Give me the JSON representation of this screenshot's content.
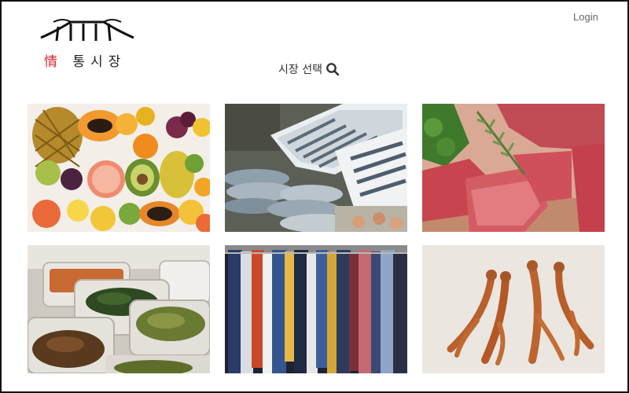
{
  "header": {
    "logo": {
      "red_char": "情",
      "rest_text": " 통시장"
    },
    "login_label": "Login"
  },
  "market_select": {
    "label": "시장 선택",
    "icon": "search-icon"
  },
  "categories": [
    {
      "id": "fruits",
      "icon": "fruit-photo"
    },
    {
      "id": "seafood",
      "icon": "fish-photo"
    },
    {
      "id": "meat",
      "icon": "meat-photo"
    },
    {
      "id": "side-dishes",
      "icon": "banchan-photo"
    },
    {
      "id": "clothing",
      "icon": "clothing-photo"
    },
    {
      "id": "ginseng",
      "icon": "ginseng-photo"
    }
  ],
  "colors": {
    "accent_red": "#e0252b",
    "text": "#333333",
    "login": "#666666"
  }
}
